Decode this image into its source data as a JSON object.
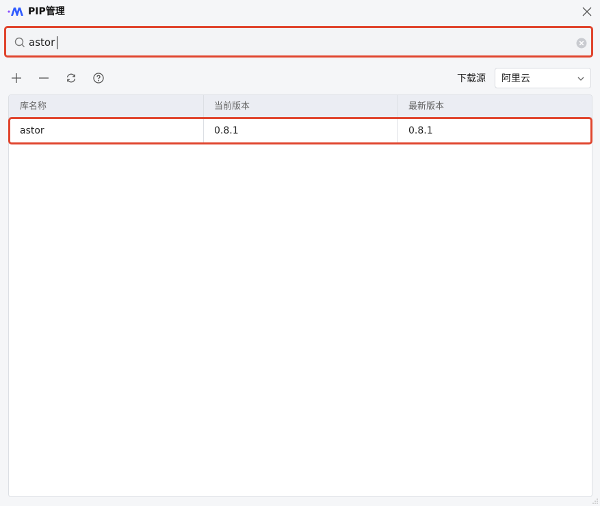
{
  "window": {
    "title": "PIP管理"
  },
  "search": {
    "value": "astor",
    "placeholder": ""
  },
  "toolbar": {
    "buttons": [
      {
        "icon": "plus-icon",
        "label": "Add"
      },
      {
        "icon": "minus-icon",
        "label": "Remove"
      },
      {
        "icon": "refresh-icon",
        "label": "Refresh"
      },
      {
        "icon": "help-icon",
        "label": "Help"
      }
    ],
    "source_label": "下载源",
    "source_value": "阿里云"
  },
  "table": {
    "columns": [
      "库名称",
      "当前版本",
      "最新版本"
    ],
    "rows": [
      [
        "astor",
        "0.8.1",
        "0.8.1"
      ]
    ]
  },
  "colors": {
    "highlight": "#e0452e",
    "header_bg": "#ebedf3",
    "logo_blue": "#2f5bff",
    "logo_purple": "#8a4dff"
  }
}
